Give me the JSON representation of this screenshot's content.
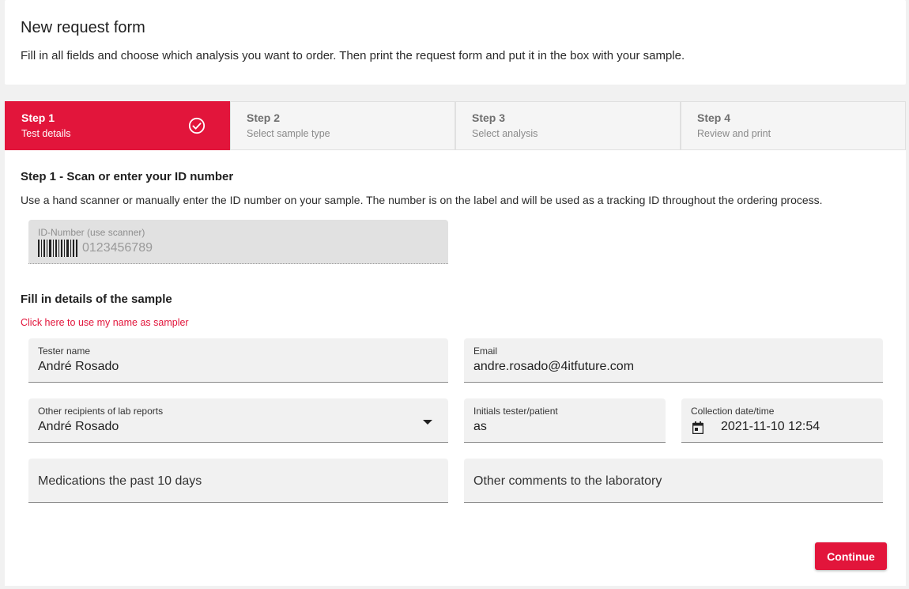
{
  "header": {
    "title": "New request form",
    "description": "Fill in all fields and choose which analysis you want to order. Then print the request form and put it in the box with your sample."
  },
  "stepper": {
    "steps": [
      {
        "title": "Step 1",
        "subtitle": "Test details",
        "state": "completed"
      },
      {
        "title": "Step 2",
        "subtitle": "Select sample type",
        "state": "inactive"
      },
      {
        "title": "Step 3",
        "subtitle": "Select analysis",
        "state": "inactive"
      },
      {
        "title": "Step 4",
        "subtitle": "Review and print",
        "state": "inactive"
      }
    ]
  },
  "id_section": {
    "title": "Step 1 - Scan or enter your ID number",
    "description": "Use a hand scanner or manually enter the ID number on your sample. The number is on the label and will be used as a tracking ID throughout the ordering process.",
    "id_field": {
      "label": "ID-Number (use scanner)",
      "placeholder": "0123456789"
    }
  },
  "sample_section": {
    "title": "Fill in details of the sample",
    "sampler_link": "Click here to use my name as sampler",
    "fields": {
      "tester_name": {
        "label": "Tester name",
        "value": "André Rosado"
      },
      "email": {
        "label": "Email",
        "value": "andre.rosado@4itfuture.com"
      },
      "other_recipients": {
        "label": "Other recipients of lab reports",
        "value": "André Rosado"
      },
      "initials": {
        "label": "Initials tester/patient",
        "value": "as"
      },
      "collection_date": {
        "label": "Collection date/time",
        "value": "2021-11-10 12:54"
      },
      "medications": {
        "placeholder": "Medications the past 10 days"
      },
      "comments": {
        "placeholder": "Other comments to the laboratory"
      }
    }
  },
  "actions": {
    "continue_label": "Continue"
  },
  "colors": {
    "accent": "#e2153b",
    "field_bg": "#f1f1f1",
    "step_inactive_bg": "#f5f5f5"
  },
  "icons": {
    "step_complete": "check-circle-icon",
    "id_field": "barcode-icon",
    "dropdown": "arrow-drop-down-icon",
    "date": "calendar-icon"
  }
}
